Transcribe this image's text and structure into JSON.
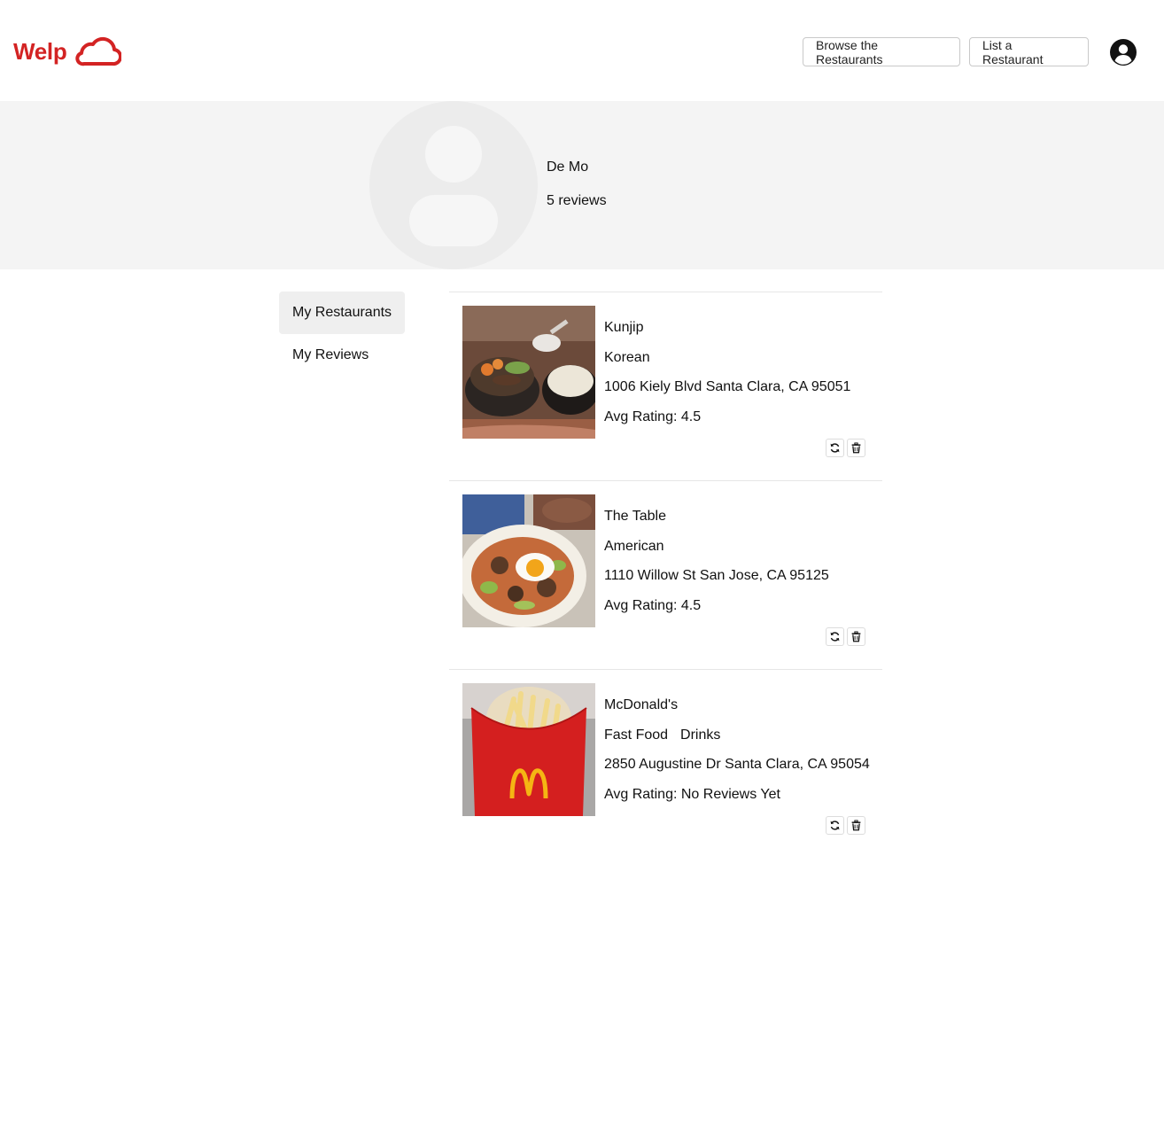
{
  "header": {
    "logo_text": "Welp",
    "brand_color": "#d32323",
    "nav": {
      "browse_label": "Browse the Restaurants",
      "list_label": "List a Restaurant"
    },
    "user_icon": "user-circle-icon"
  },
  "profile": {
    "name": "De Mo",
    "reviews": "5 reviews",
    "avatar_icon": "default-avatar-icon"
  },
  "sidebar": {
    "items": [
      {
        "label": "My Restaurants",
        "active": true
      },
      {
        "label": "My Reviews",
        "active": false
      }
    ]
  },
  "restaurants": [
    {
      "name": "Kunjip",
      "categories": [
        "Korean"
      ],
      "address": "1006 Kiely Blvd Santa Clara, CA 95051",
      "rating": "Avg Rating: 4.5"
    },
    {
      "name": "The Table",
      "categories": [
        "American"
      ],
      "address": "1110 Willow St San Jose, CA 95125",
      "rating": "Avg Rating: 4.5"
    },
    {
      "name": "McDonald's",
      "categories": [
        "Fast Food",
        "Drinks"
      ],
      "address": "2850 Augustine Dr Santa Clara, CA 95054",
      "rating": "Avg Rating: No Reviews Yet"
    }
  ],
  "icons": {
    "update": "refresh-icon",
    "delete": "trash-icon"
  }
}
